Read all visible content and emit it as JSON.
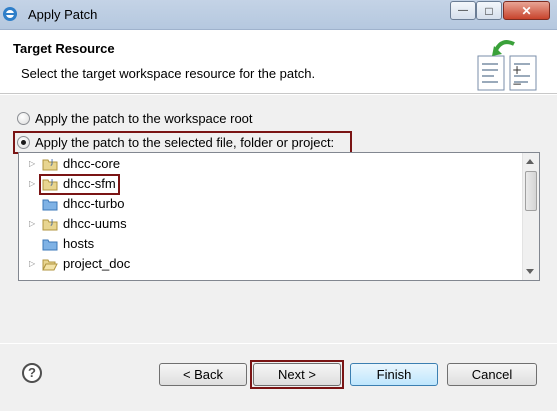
{
  "window": {
    "title": "Apply Patch",
    "min_glyph": "—",
    "max_glyph": "□",
    "close_glyph": "✕"
  },
  "header": {
    "title": "Target Resource",
    "description": "Select the target workspace resource for the patch."
  },
  "options": {
    "workspace_root": "Apply the patch to the workspace root",
    "selected_resource": "Apply the patch to the selected file, folder or project:",
    "selected": "selected_resource"
  },
  "tree": {
    "items": [
      {
        "label": "dhcc-core",
        "icon": "project-folder-icon",
        "expandable": true
      },
      {
        "label": "dhcc-sfm",
        "icon": "project-folder-icon",
        "expandable": true
      },
      {
        "label": "dhcc-turbo",
        "icon": "folder-icon",
        "expandable": false
      },
      {
        "label": "dhcc-uums",
        "icon": "project-folder-icon",
        "expandable": true
      },
      {
        "label": "hosts",
        "icon": "folder-icon",
        "expandable": false
      },
      {
        "label": "project_doc",
        "icon": "open-folder-icon",
        "expandable": true
      }
    ]
  },
  "buttons": {
    "help": "?",
    "back": "< Back",
    "next": "Next >",
    "finish": "Finish",
    "cancel": "Cancel"
  },
  "colors": {
    "highlight": "#7a1414",
    "folder": "#4a90d9"
  }
}
